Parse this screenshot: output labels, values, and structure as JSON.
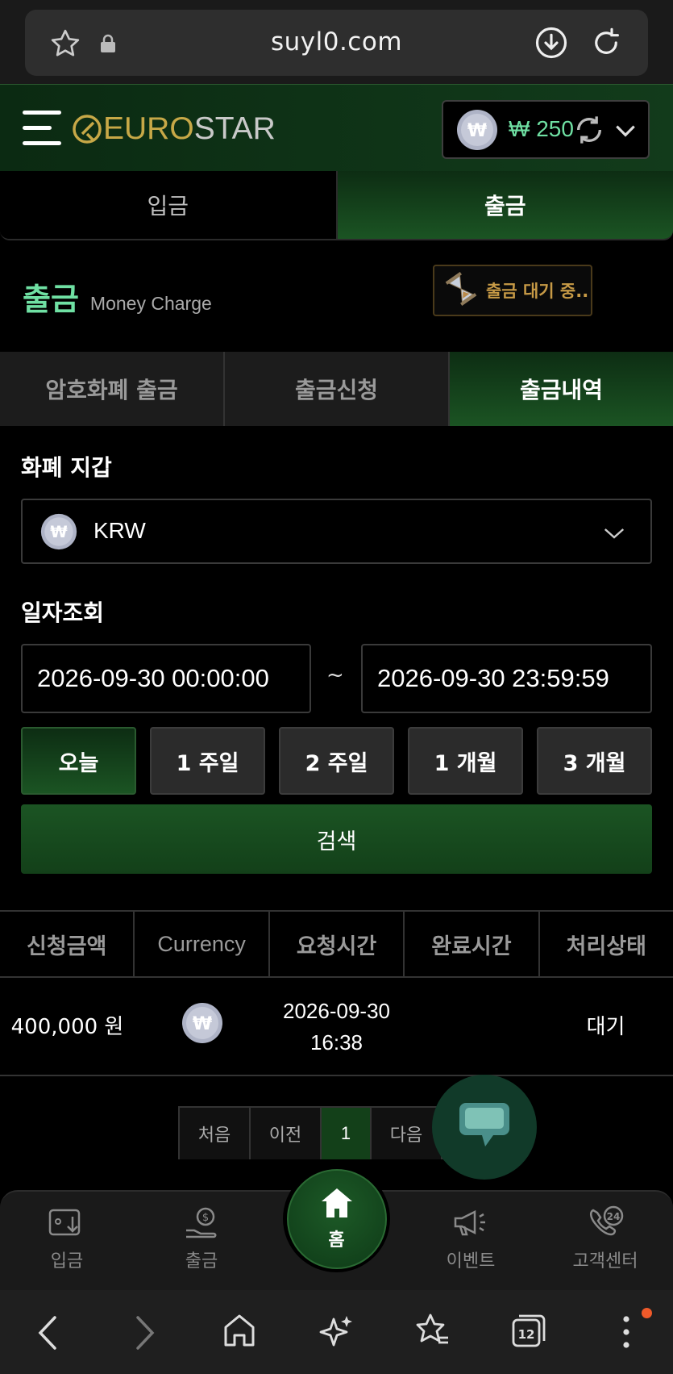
{
  "browser": {
    "url": "suyl0.com",
    "tab_count": "12"
  },
  "header": {
    "logo_part1": "EURO",
    "logo_part2": "STAR",
    "balance": "₩ 250",
    "coin_symbol": "₩"
  },
  "top_tabs": [
    {
      "label": "입금",
      "active": false
    },
    {
      "label": "출금",
      "active": true
    }
  ],
  "section": {
    "title": "출금",
    "subtitle": "Money Charge",
    "pending_label": "출금 대기 중.."
  },
  "sub_tabs": [
    {
      "label": "암호화폐 출금",
      "active": false
    },
    {
      "label": "출금신청",
      "active": false
    },
    {
      "label": "출금내역",
      "active": true
    }
  ],
  "wallet": {
    "label": "화폐 지갑",
    "selected": "KRW"
  },
  "date_query": {
    "label": "일자조회",
    "from": "2026-09-30 00:00:00",
    "to": "2026-09-30 23:59:59",
    "separator": "~"
  },
  "period_buttons": [
    "오늘",
    "1 주일",
    "2 주일",
    "1 개월",
    "3 개월"
  ],
  "search_label": "검색",
  "table": {
    "headers": [
      "신청금액",
      "Currency",
      "요청시간",
      "완료시간",
      "처리상태"
    ],
    "rows": [
      {
        "amount": "400,000 원",
        "request_date": "2026-09-30",
        "request_time": "16:38",
        "complete_time": "",
        "status": "대기"
      }
    ]
  },
  "pagination": {
    "first": "처음",
    "prev": "이전",
    "current": "1",
    "next": "다음"
  },
  "bottom_nav": {
    "deposit": "입금",
    "withdraw": "출금",
    "home": "홈",
    "event": "이벤트",
    "support": "고객센터"
  },
  "colors": {
    "accent_green": "#6fe0a3",
    "active_tab": "#1b5423",
    "logo_gold": "#c7a847",
    "pending_text": "#c79a46"
  }
}
